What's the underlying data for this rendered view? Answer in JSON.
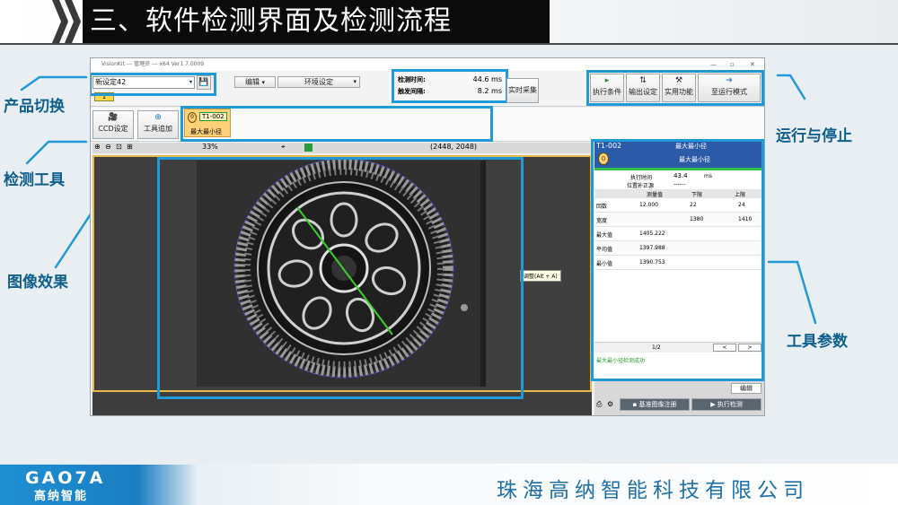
{
  "slide": {
    "title": "三、软件检测界面及检测流程",
    "company": "珠海高纳智能科技有限公司",
    "logo_text": "GAO7A",
    "logo_subtitle": "高纳智能"
  },
  "annotations": {
    "product_switch": "产品切换",
    "detection_tool": "检测工具",
    "image_effect": "图像效果",
    "detection_time": "检测时间",
    "run_stop": "运行与停止",
    "tool_params": "工具参数"
  },
  "app": {
    "window_title": "VisionKit --- 管理员 --- x64 Ver1.7.0009",
    "product_select": "新设定42",
    "product_id": "1",
    "menu_edit": "编辑",
    "menu_env": "环境设定",
    "timing": {
      "detect_label": "检测时间:",
      "detect_value": "44.6 ms",
      "trigger_label": "触发间隔:",
      "trigger_value": "8.2 ms"
    },
    "realtime_capture": "实时采集",
    "buttons": {
      "exec_condition": "执行条件",
      "output_setting": "输出设定",
      "util_function": "实用功能",
      "to_run_mode": "至运行模式"
    },
    "ccd_setting": "CCD设定",
    "add_tool": "工具追加",
    "tool_chip": {
      "id": "T1-002",
      "name": "最大最小径"
    },
    "zoom": "33%",
    "coords": "(2448, 2048)",
    "tooltip": "调整(Alt + A)",
    "params": {
      "tool_id": "T1-002",
      "header_title": "最大最小径",
      "header_sub": "最大最小径",
      "exec_time_label": "执行时间",
      "exec_time_value": "43.4",
      "exec_time_unit": "ms",
      "pos_comp_label": "位置补正源",
      "pos_comp_value": "------",
      "col_measured": "测量值",
      "col_lower": "下限",
      "col_upper": "上限",
      "rows": [
        {
          "label": "回数",
          "measured": "12.000",
          "lower": "22",
          "upper": "24"
        },
        {
          "label": "宽度",
          "measured": "",
          "lower": "1380",
          "upper": "1410"
        },
        {
          "label": "最大值",
          "measured": "1405.222",
          "lower": "",
          "upper": ""
        },
        {
          "label": "平均值",
          "measured": "1397.988",
          "lower": "",
          "upper": ""
        },
        {
          "label": "最小值",
          "measured": "1390.753",
          "lower": "",
          "upper": ""
        }
      ],
      "page": "1/2",
      "prev": "<",
      "next": ">",
      "status_text": "最大最小径检测成功",
      "edit_button": "编辑",
      "register_button": "基准图像注册",
      "execute_button": "执行检测"
    }
  }
}
